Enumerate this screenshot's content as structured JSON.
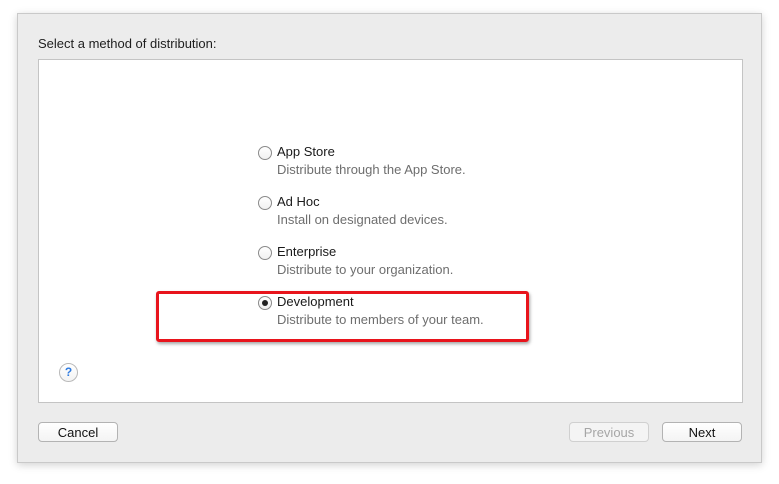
{
  "dialog": {
    "prompt": "Select a method of distribution:",
    "options": [
      {
        "label": "App Store",
        "description": "Distribute through the App Store.",
        "selected": false
      },
      {
        "label": "Ad Hoc",
        "description": "Install on designated devices.",
        "selected": false
      },
      {
        "label": "Enterprise",
        "description": "Distribute to your organization.",
        "selected": false
      },
      {
        "label": "Development",
        "description": "Distribute to members of your team.",
        "selected": true
      }
    ],
    "help_symbol": "?",
    "highlight_color": "#e8141c"
  },
  "buttons": {
    "cancel": "Cancel",
    "previous": "Previous",
    "previous_enabled": false,
    "next": "Next"
  }
}
